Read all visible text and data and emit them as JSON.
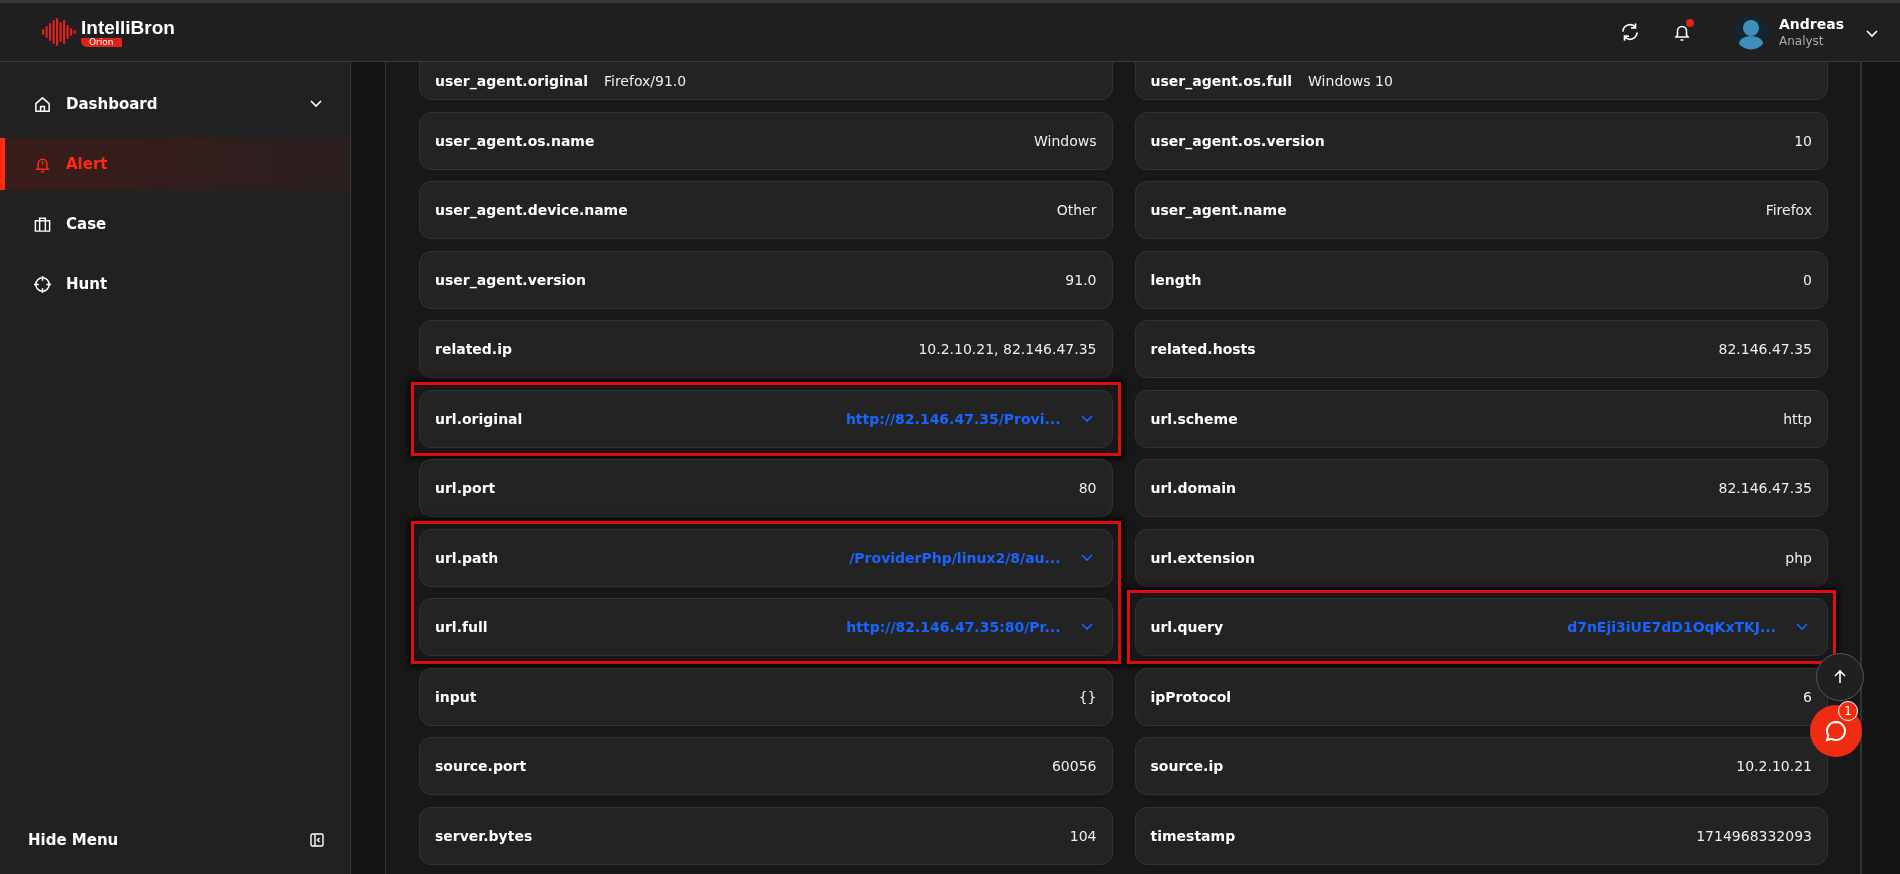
{
  "header": {
    "logo": {
      "name": "IntelliBron",
      "sub": "Orion"
    },
    "notifications": {
      "unread": true
    },
    "user": {
      "name": "Andreas",
      "role": "Analyst"
    }
  },
  "sidebar": {
    "items": [
      {
        "label": "Dashboard",
        "selected": false,
        "expandable": true
      },
      {
        "label": "Alert",
        "selected": true,
        "expandable": false
      },
      {
        "label": "Case",
        "selected": false,
        "expandable": false
      },
      {
        "label": "Hunt",
        "selected": false,
        "expandable": false
      }
    ],
    "footer": "Hide Menu"
  },
  "details": {
    "columns": [
      [
        {
          "label": "user_agent.original",
          "value": "Firefox/91.0",
          "kind": "text",
          "highlighted": false
        },
        {
          "label": "user_agent.os.name",
          "value": "Windows",
          "kind": "text",
          "highlighted": false
        },
        {
          "label": "user_agent.device.name",
          "value": "Other",
          "kind": "text",
          "highlighted": false
        },
        {
          "label": "user_agent.version",
          "value": "91.0",
          "kind": "text",
          "highlighted": false
        },
        {
          "label": "related.ip",
          "value": "10.2.10.21, 82.146.47.35",
          "kind": "text",
          "highlighted": false
        },
        {
          "label": "url.original",
          "value": "http://82.146.47.35/Provi...",
          "kind": "expandable",
          "highlighted": true
        },
        {
          "label": "url.port",
          "value": "80",
          "kind": "text",
          "highlighted": false
        },
        {
          "label": "url.path",
          "value": "/ProviderPhp/linux2/8/au...",
          "kind": "expandable",
          "highlighted": true
        },
        {
          "label": "url.full",
          "value": "http://82.146.47.35:80/Pr...",
          "kind": "expandable",
          "highlighted": true
        },
        {
          "label": "input",
          "value": "{}",
          "kind": "text",
          "highlighted": false
        },
        {
          "label": "source.port",
          "value": "60056",
          "kind": "text",
          "highlighted": false
        },
        {
          "label": "server.bytes",
          "value": "104",
          "kind": "text",
          "highlighted": false
        }
      ],
      [
        {
          "label": "user_agent.os.full",
          "value": "Windows 10",
          "kind": "text",
          "highlighted": false
        },
        {
          "label": "user_agent.os.version",
          "value": "10",
          "kind": "text",
          "highlighted": false
        },
        {
          "label": "user_agent.name",
          "value": "Firefox",
          "kind": "text",
          "highlighted": false
        },
        {
          "label": "length",
          "value": "0",
          "kind": "text",
          "highlighted": false
        },
        {
          "label": "related.hosts",
          "value": "82.146.47.35",
          "kind": "text",
          "highlighted": false
        },
        {
          "label": "url.scheme",
          "value": "http",
          "kind": "text",
          "highlighted": false
        },
        {
          "label": "url.domain",
          "value": "82.146.47.35",
          "kind": "text",
          "highlighted": false
        },
        {
          "label": "url.extension",
          "value": "php",
          "kind": "text",
          "highlighted": false
        },
        {
          "label": "url.query",
          "value": "d7nEji3iUE7dD1OqKxTKJ...",
          "kind": "expandable",
          "highlighted": true
        },
        {
          "label": "ipProtocol",
          "value": "6",
          "kind": "text",
          "highlighted": false
        },
        {
          "label": "source.ip",
          "value": "10.2.10.21",
          "kind": "text",
          "highlighted": false
        },
        {
          "label": "timestamp",
          "value": "1714968332093",
          "kind": "text",
          "highlighted": false
        }
      ]
    ]
  },
  "chat": {
    "badge": "1"
  }
}
